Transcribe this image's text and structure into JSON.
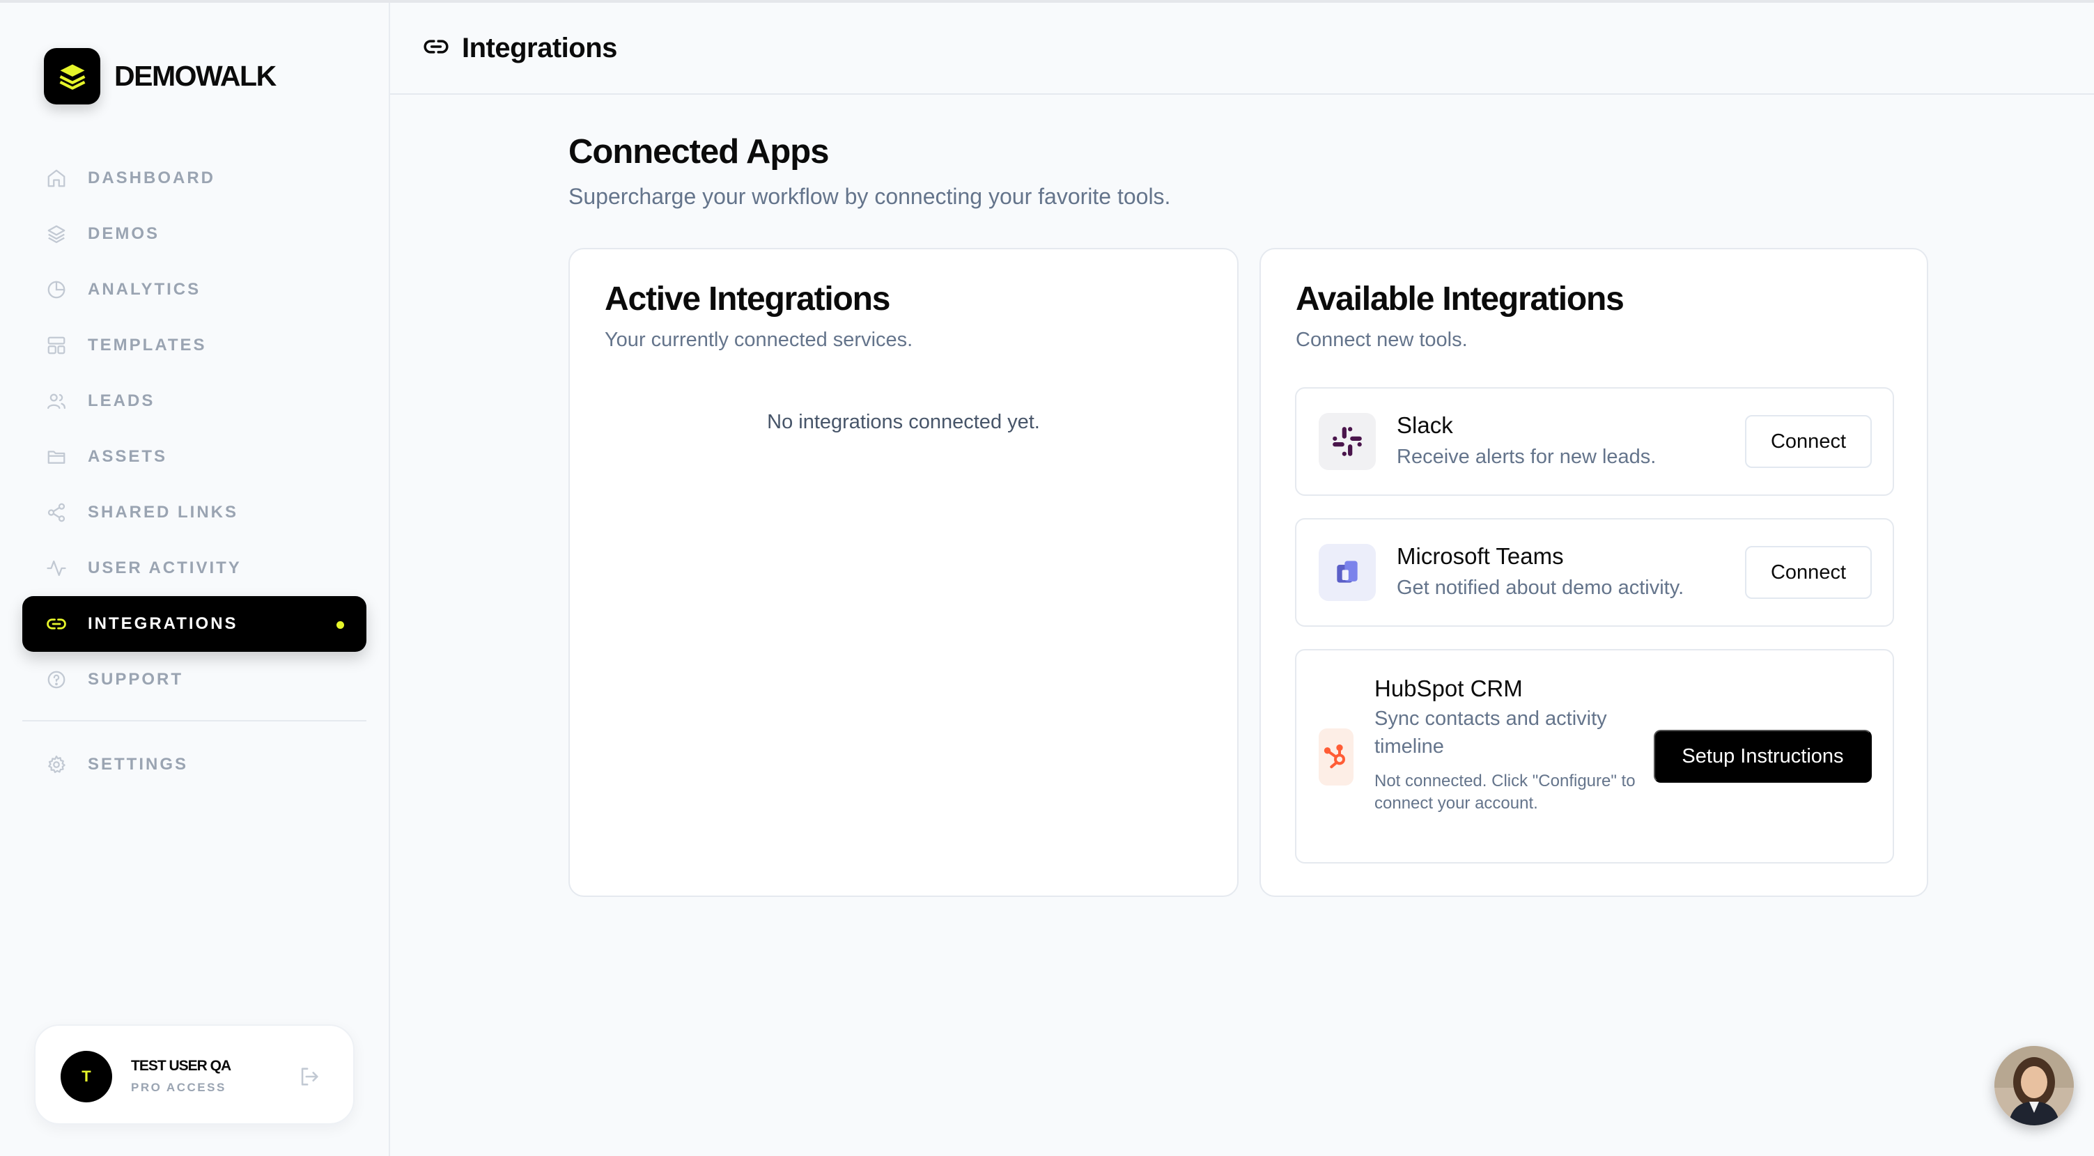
{
  "brand": {
    "name": "DEMOWALK"
  },
  "sidebar": {
    "items": [
      {
        "label": "DASHBOARD",
        "icon": "home-icon"
      },
      {
        "label": "DEMOS",
        "icon": "layers-icon"
      },
      {
        "label": "ANALYTICS",
        "icon": "pie-chart-icon"
      },
      {
        "label": "TEMPLATES",
        "icon": "template-icon"
      },
      {
        "label": "LEADS",
        "icon": "users-icon"
      },
      {
        "label": "ASSETS",
        "icon": "folder-icon"
      },
      {
        "label": "SHARED LINKS",
        "icon": "share-icon"
      },
      {
        "label": "USER ACTIVITY",
        "icon": "activity-icon"
      },
      {
        "label": "INTEGRATIONS",
        "icon": "link-icon",
        "active": true
      },
      {
        "label": "SUPPORT",
        "icon": "help-icon"
      }
    ],
    "settings": {
      "label": "SETTINGS",
      "icon": "gear-icon"
    }
  },
  "user": {
    "initial": "T",
    "name": "TEST USER QA",
    "plan": "PRO ACCESS"
  },
  "header": {
    "title": "Integrations"
  },
  "main": {
    "title": "Connected Apps",
    "subtitle": "Supercharge your workflow by connecting your favorite tools."
  },
  "active_integrations": {
    "title": "Active Integrations",
    "subtitle": "Your currently connected services.",
    "empty": "No integrations connected yet."
  },
  "available_integrations": {
    "title": "Available Integrations",
    "subtitle": "Connect new tools.",
    "items": [
      {
        "name": "Slack",
        "description": "Receive alerts for new leads.",
        "action": "Connect",
        "icon": "slack-icon"
      },
      {
        "name": "Microsoft Teams",
        "description": "Get notified about demo activity.",
        "action": "Connect",
        "icon": "teams-icon"
      },
      {
        "name": "HubSpot CRM",
        "description": "Sync contacts and activity timeline",
        "note": "Not connected. Click \"Configure\" to connect your account.",
        "action": "Setup Instructions",
        "icon": "hubspot-icon"
      }
    ]
  },
  "colors": {
    "accent": "#e6f52a",
    "primary": "#000000",
    "muted": "#9aa4b2",
    "hubspot": "#ff5c35",
    "slack": "#4a154b",
    "teams": "#5b5fc7"
  }
}
